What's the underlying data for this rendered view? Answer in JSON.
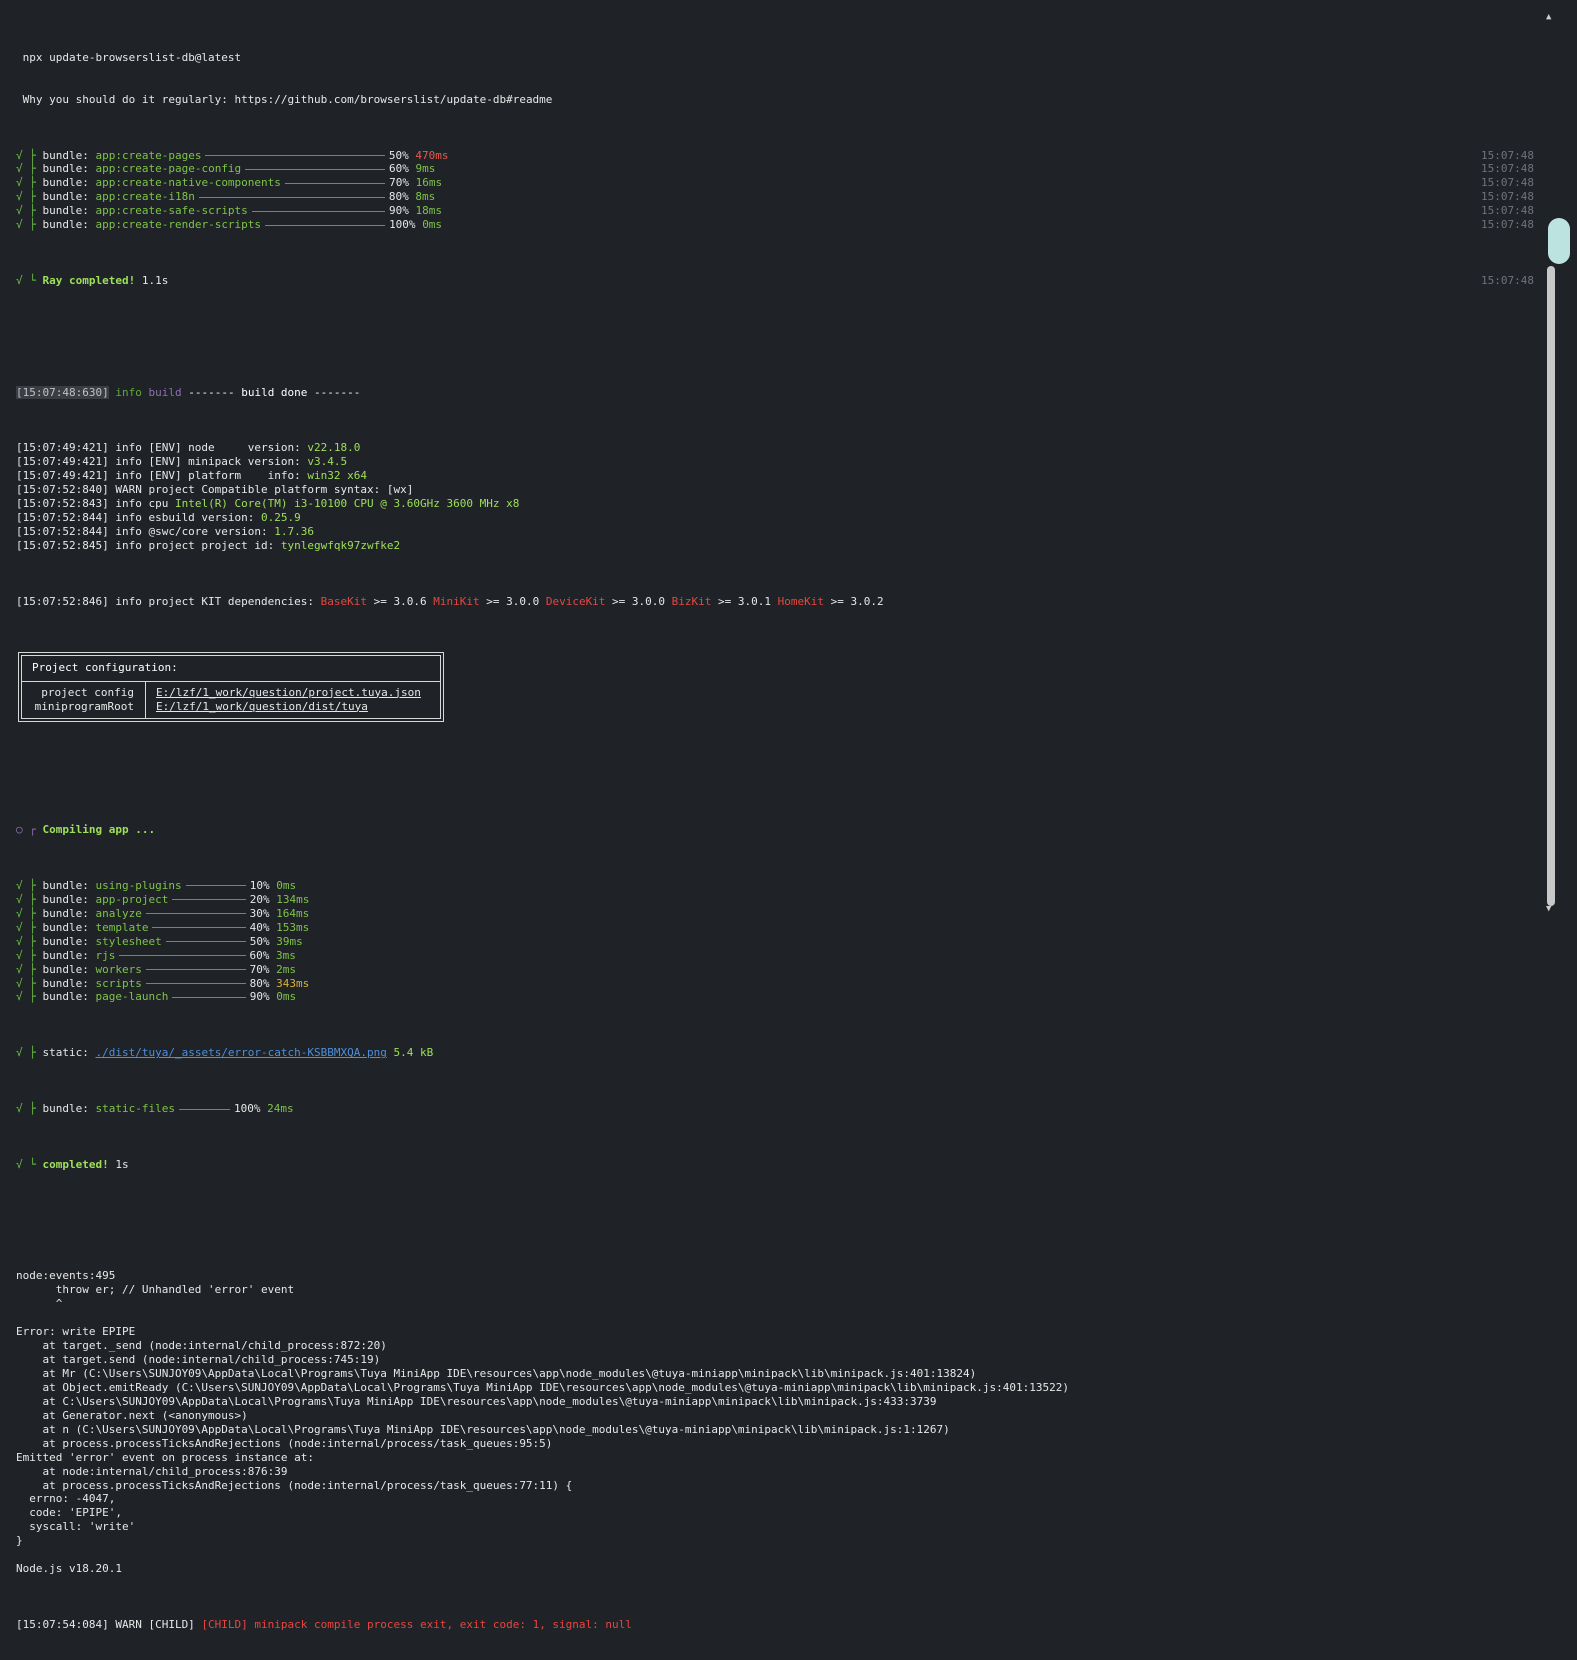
{
  "header_lines": [
    "npx update-browserslist-db@latest",
    "Why you should do it regularly: https://github.com/browserslist/update-db#readme"
  ],
  "ray_bundles": [
    {
      "name": "app:create-pages",
      "pct": "50%",
      "time": "470ms",
      "ts": "15:07:48",
      "time_color": "red"
    },
    {
      "name": "app:create-page-config",
      "pct": "60%",
      "time": "9ms",
      "ts": "15:07:48",
      "time_color": "green"
    },
    {
      "name": "app:create-native-components",
      "pct": "70%",
      "time": "16ms",
      "ts": "15:07:48",
      "time_color": "green"
    },
    {
      "name": "app:create-i18n",
      "pct": "80%",
      "time": "8ms",
      "ts": "15:07:48",
      "time_color": "green"
    },
    {
      "name": "app:create-safe-scripts",
      "pct": "90%",
      "time": "18ms",
      "ts": "15:07:48",
      "time_color": "green"
    },
    {
      "name": "app:create-render-scripts",
      "pct": "100%",
      "time": "0ms",
      "ts": "15:07:48",
      "time_color": "green"
    }
  ],
  "ray_completed": {
    "label": "Ray completed!",
    "time": "1.1s",
    "ts": "15:07:48"
  },
  "build_done": {
    "ts": "[15:07:48:630]",
    "info": "info",
    "tag": "build",
    "text": "------- build done -------"
  },
  "env_lines": [
    {
      "prefix": "[15:07:49:421] info [ENV] node     version: ",
      "value": "v22.18.0"
    },
    {
      "prefix": "[15:07:49:421] info [ENV] minipack version: ",
      "value": "v3.4.5"
    },
    {
      "prefix": "[15:07:49:421] info [ENV] platform    info: ",
      "value": "win32 x64"
    },
    {
      "prefix": "[15:07:52:840] WARN project Compatible platform syntax: [wx]",
      "value": ""
    },
    {
      "prefix": "[15:07:52:843] info cpu ",
      "value": "Intel(R) Core(TM) i3-10100 CPU @ 3.60GHz 3600 MHz x8"
    },
    {
      "prefix": "[15:07:52:844] info esbuild version: ",
      "value": "0.25.9"
    },
    {
      "prefix": "[15:07:52:844] info @swc/core version: ",
      "value": "1.7.36"
    },
    {
      "prefix": "[15:07:52:845] info project project id: ",
      "value": "tynlegwfqk97zwfke2"
    }
  ],
  "kit_line": {
    "prefix": "[15:07:52:846] info project KIT dependencies: ",
    "kits": [
      {
        "name": "BaseKit",
        "ver": " >= 3.0.6 "
      },
      {
        "name": "MiniKit",
        "ver": " >= 3.0.0 "
      },
      {
        "name": "DeviceKit",
        "ver": " >= 3.0.0 "
      },
      {
        "name": "BizKit",
        "ver": " >= 3.0.1 "
      },
      {
        "name": "HomeKit",
        "ver": " >= 3.0.2"
      }
    ]
  },
  "config_table": {
    "title": "Project configuration:",
    "rows": [
      {
        "key": "project config",
        "value": "E:/lzf/1_work/question/project.tuya.json"
      },
      {
        "key": "miniprogramRoot",
        "value": "E:/lzf/1_work/question/dist/tuya"
      }
    ]
  },
  "compiling": {
    "label": "Compiling app ..."
  },
  "app_bundles": [
    {
      "kind": "bundle:",
      "name": "using-plugins",
      "pct": "10%",
      "time": "0ms",
      "time_color": "green"
    },
    {
      "kind": "bundle:",
      "name": "app-project",
      "pct": "20%",
      "time": "134ms",
      "time_color": "green"
    },
    {
      "kind": "bundle:",
      "name": "analyze",
      "pct": "30%",
      "time": "164ms",
      "time_color": "green"
    },
    {
      "kind": "bundle:",
      "name": "template",
      "pct": "40%",
      "time": "153ms",
      "time_color": "green"
    },
    {
      "kind": "bundle:",
      "name": "stylesheet",
      "pct": "50%",
      "time": "39ms",
      "time_color": "green"
    },
    {
      "kind": "bundle:",
      "name": "rjs",
      "pct": "60%",
      "time": "3ms",
      "time_color": "green"
    },
    {
      "kind": "bundle:",
      "name": "workers",
      "pct": "70%",
      "time": "2ms",
      "time_color": "green"
    },
    {
      "kind": "bundle:",
      "name": "scripts",
      "pct": "80%",
      "time": "343ms",
      "time_color": "yellow"
    },
    {
      "kind": "bundle:",
      "name": "page-launch",
      "pct": "90%",
      "time": "0ms",
      "time_color": "green"
    }
  ],
  "static_line": {
    "kind": "static:",
    "path": "./dist/tuya/_assets/error-catch-KSBBMXQA.png",
    "size": "5.4 kB"
  },
  "static_files": {
    "kind": "bundle:",
    "name": "static-files",
    "pct": "100%",
    "time": "24ms"
  },
  "app_completed": {
    "label": "completed!",
    "time": "1s"
  },
  "error_block": [
    "node:events:495",
    "      throw er; // Unhandled 'error' event",
    "      ^",
    "",
    "Error: write EPIPE",
    "    at target._send (node:internal/child_process:872:20)",
    "    at target.send (node:internal/child_process:745:19)",
    "    at Mr (C:\\Users\\SUNJOY09\\AppData\\Local\\Programs\\Tuya MiniApp IDE\\resources\\app\\node_modules\\@tuya-miniapp\\minipack\\lib\\minipack.js:401:13824)",
    "    at Object.emitReady (C:\\Users\\SUNJOY09\\AppData\\Local\\Programs\\Tuya MiniApp IDE\\resources\\app\\node_modules\\@tuya-miniapp\\minipack\\lib\\minipack.js:401:13522)",
    "    at C:\\Users\\SUNJOY09\\AppData\\Local\\Programs\\Tuya MiniApp IDE\\resources\\app\\node_modules\\@tuya-miniapp\\minipack\\lib\\minipack.js:433:3739",
    "    at Generator.next (<anonymous>)",
    "    at n (C:\\Users\\SUNJOY09\\AppData\\Local\\Programs\\Tuya MiniApp IDE\\resources\\app\\node_modules\\@tuya-miniapp\\minipack\\lib\\minipack.js:1:1267)",
    "    at process.processTicksAndRejections (node:internal/process/task_queues:95:5)",
    "Emitted 'error' event on process instance at:",
    "    at node:internal/child_process:876:39",
    "    at process.processTicksAndRejections (node:internal/process/task_queues:77:11) {",
    "  errno: -4047,",
    "  code: 'EPIPE',",
    "  syscall: 'write'",
    "}",
    "",
    "Node.js v18.20.1"
  ],
  "final_warn": {
    "prefix": "[15:07:54:084] WARN [CHILD] ",
    "message": "[CHILD] minipack compile process exit, exit code: 1, signal: null"
  },
  "scrollbar": {
    "up": "▲",
    "down": "▼"
  },
  "colors": {
    "background": "#1f2227",
    "green": "#7ec447",
    "red": "#e8463f",
    "link": "#4f8fd8"
  }
}
